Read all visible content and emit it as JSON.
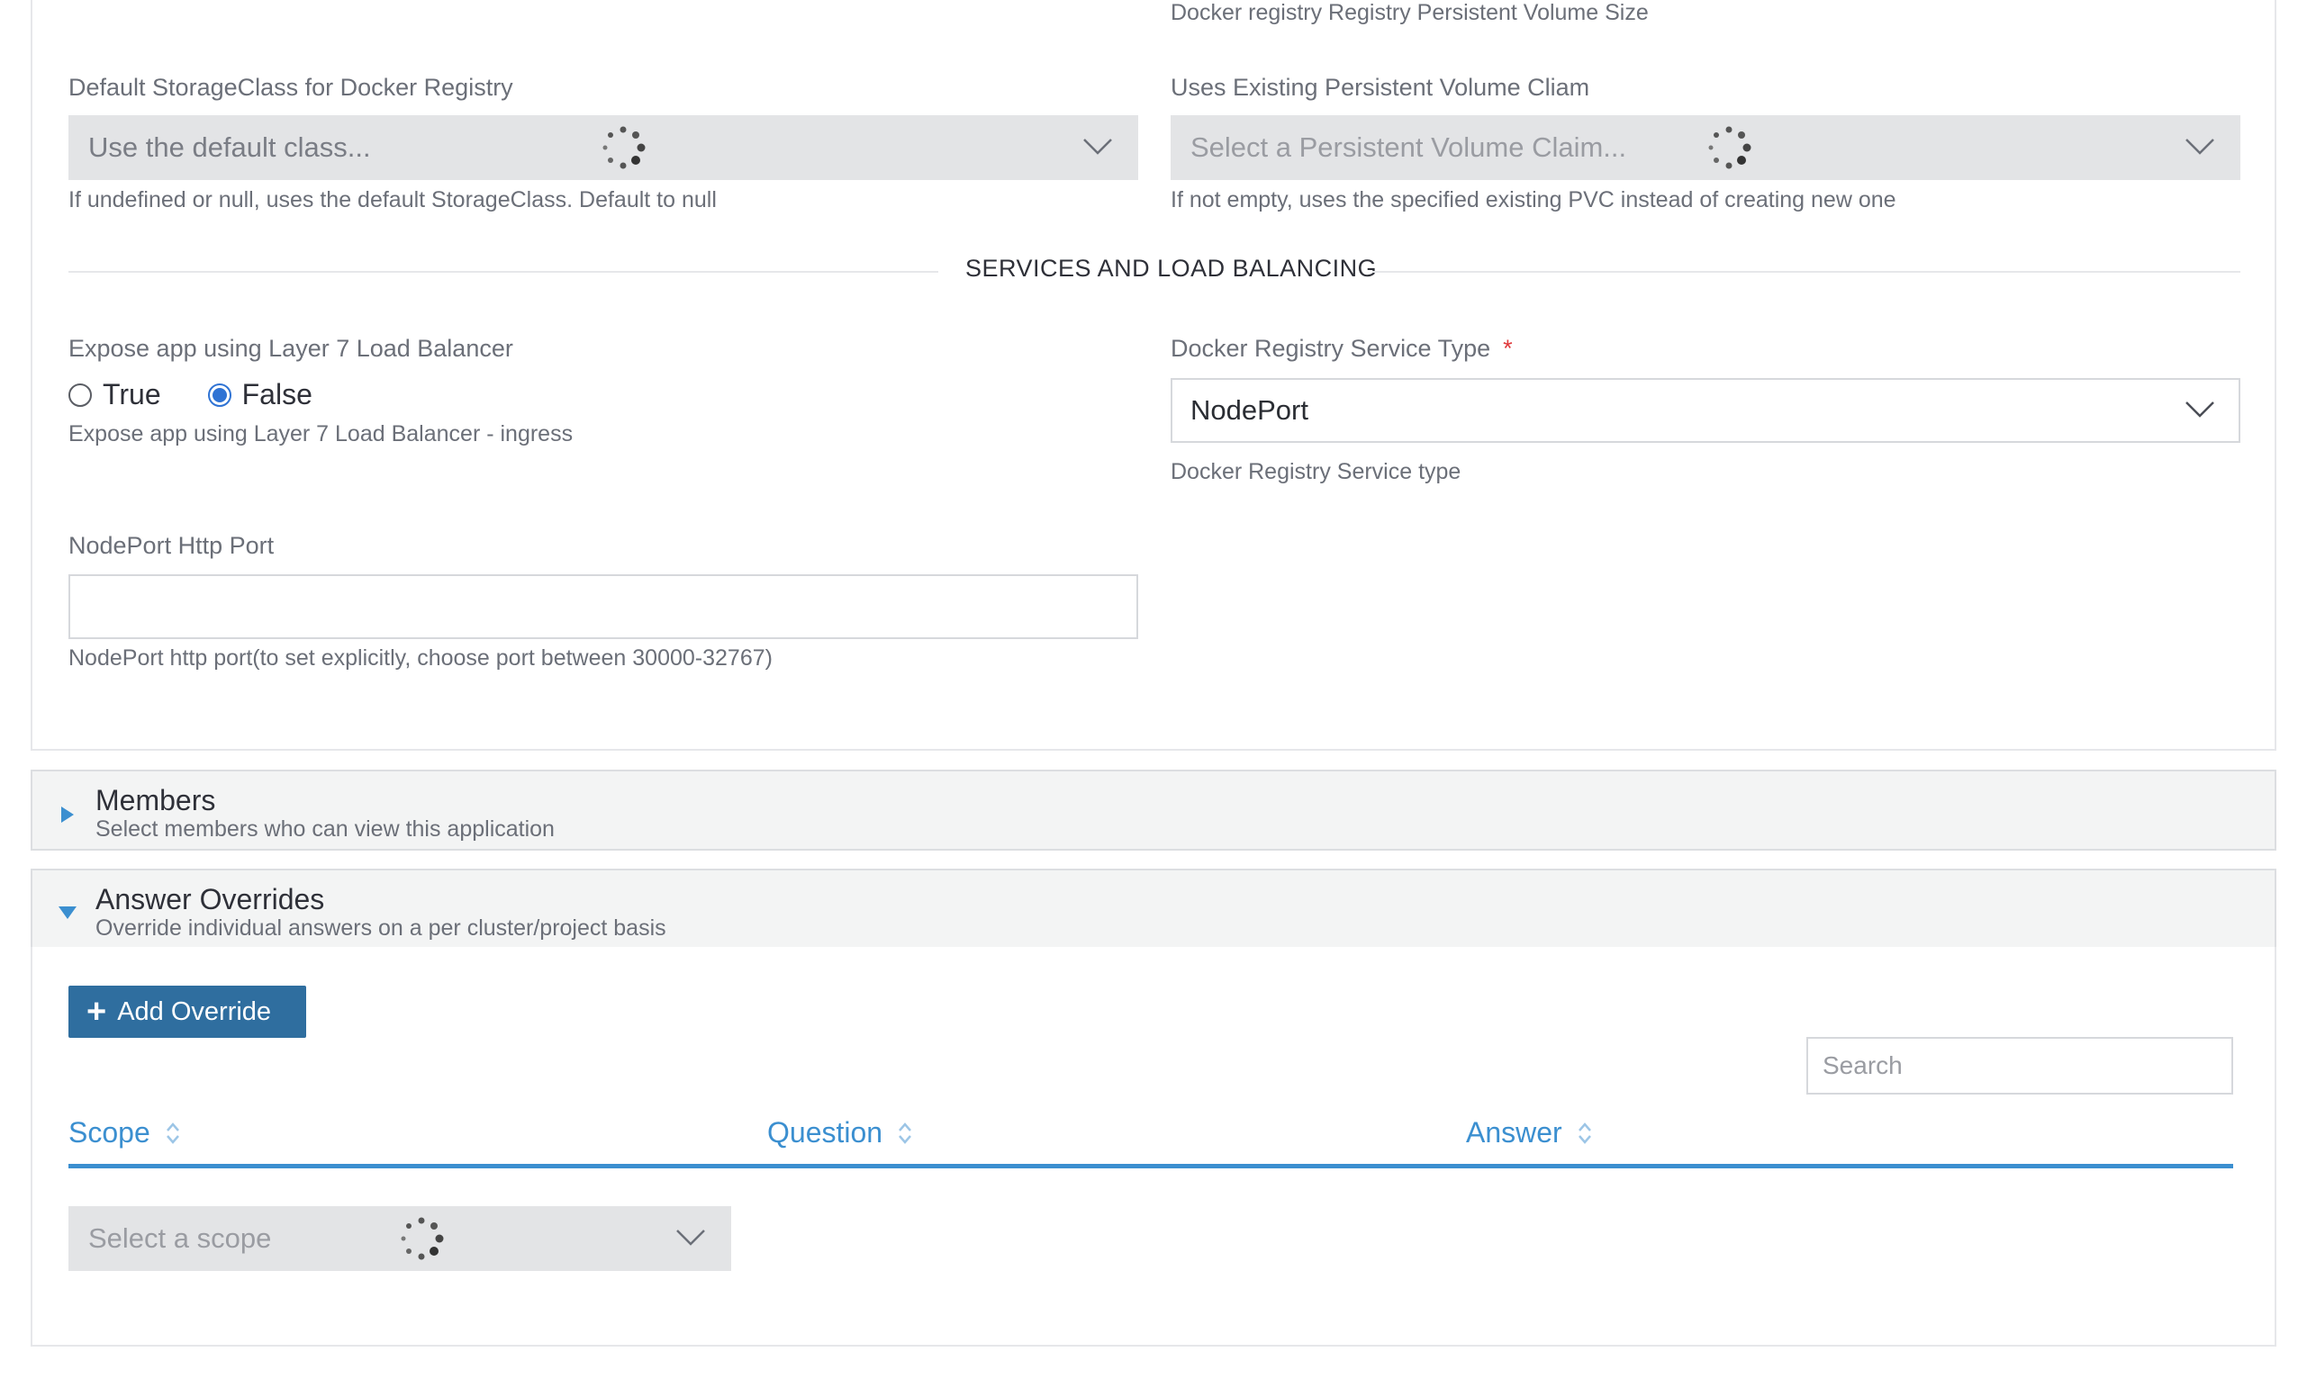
{
  "storage": {
    "pv_size_help": "Docker registry Registry Persistent Volume Size",
    "storageclass_label": "Default StorageClass for Docker Registry",
    "storageclass_placeholder": "Use the default class...",
    "storageclass_help": "If undefined or null, uses the default StorageClass. Default to null",
    "pvc_label": "Uses Existing Persistent Volume Cliam",
    "pvc_placeholder": "Select a Persistent Volume Claim...",
    "pvc_help": "If not empty, uses the specified existing PVC instead of creating new one"
  },
  "services": {
    "section_title": "SERVICES AND LOAD BALANCING",
    "l7_label": "Expose app using Layer 7 Load Balancer",
    "l7_options": [
      "True",
      "False"
    ],
    "l7_selected": "False",
    "l7_help": "Expose app using Layer 7 Load Balancer - ingress",
    "service_type_label": "Docker Registry Service Type",
    "service_type_required": "*",
    "service_type_value": "NodePort",
    "service_type_help": "Docker Registry Service type",
    "nodeport_label": "NodePort Http Port",
    "nodeport_value": "",
    "nodeport_help": "NodePort http port(to set explicitly, choose port between 30000-32767)"
  },
  "members": {
    "title": "Members",
    "subtitle": "Select members who can view this application",
    "expanded": false
  },
  "overrides": {
    "title": "Answer Overrides",
    "subtitle": "Override individual answers on a per cluster/project basis",
    "expanded": true,
    "add_button": "Add Override",
    "search_placeholder": "Search",
    "columns": [
      "Scope",
      "Question",
      "Answer"
    ],
    "scope_placeholder": "Select a scope"
  },
  "colors": {
    "accent": "#3b8fd0",
    "primary_button": "#2f6e9f",
    "required": "#e0393c",
    "radio_checked": "#2f73d4"
  }
}
